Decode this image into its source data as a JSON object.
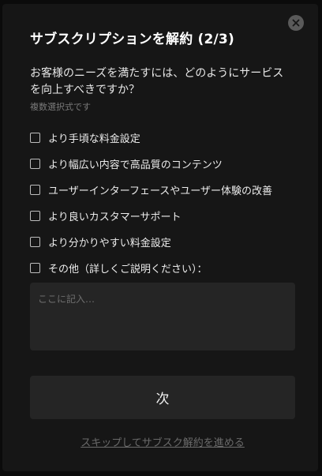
{
  "modal": {
    "title": "サブスクリプションを解約 (2/3)",
    "close_icon": "close-icon",
    "question": "お客様のニーズを満たすには、どのようにサービスを向上すべきですか？",
    "hint": "複数選択式です",
    "options": [
      {
        "label": "より手頃な料金設定",
        "checked": false
      },
      {
        "label": "より幅広い内容で高品質のコンテンツ",
        "checked": false
      },
      {
        "label": "ユーザーインターフェースやユーザー体験の改善",
        "checked": false
      },
      {
        "label": "より良いカスタマーサポート",
        "checked": false
      },
      {
        "label": "より分かりやすい料金設定",
        "checked": false
      },
      {
        "label": "その他（詳しくご説明ください）：",
        "checked": false
      }
    ],
    "textarea": {
      "value": "",
      "placeholder": "ここに記入…"
    },
    "next_label": "次",
    "skip_label": "スキップしてサブスク解約を進める"
  },
  "colors": {
    "background": "#0b0b0b",
    "modal": "#161616",
    "input": "#252525",
    "text": "#ffffff",
    "muted": "#7a7a7a"
  }
}
